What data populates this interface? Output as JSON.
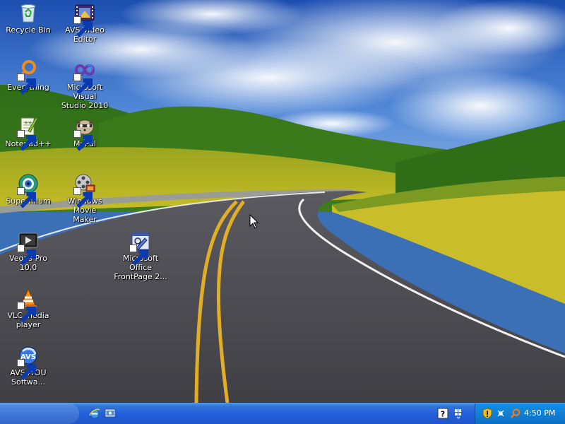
{
  "desktop": {
    "icons": [
      {
        "label": "Recycle Bin",
        "icon": "recycle-bin-icon",
        "shortcut": false
      },
      {
        "label": "AVS Video\nEditor",
        "icon": "film-strip-icon",
        "shortcut": true
      },
      {
        "label": "Everything",
        "icon": "magnifier-ring-icon",
        "shortcut": true
      },
      {
        "label": "Microsoft Visual\nStudio 2010",
        "icon": "infinity-icon",
        "shortcut": true
      },
      {
        "label": "Notepad++",
        "icon": "notepad-icon",
        "shortcut": true
      },
      {
        "label": "MyPal",
        "icon": "raccoon-icon",
        "shortcut": true
      },
      {
        "label": "Supermium",
        "icon": "globe-eye-icon",
        "shortcut": true
      },
      {
        "label": "Windows Movie\nMaker",
        "icon": "film-reel-icon",
        "shortcut": true
      },
      {
        "label": "Vegas Pro 10.0",
        "icon": "monitor-play-icon",
        "shortcut": true
      },
      {
        "label": "Microsoft Office\nFrontPage 2...",
        "icon": "frontpage-icon",
        "shortcut": true
      },
      {
        "label": "VLC media\nplayer",
        "icon": "traffic-cone-icon",
        "shortcut": true
      },
      {
        "label": "AVS4YOU\nSoftwa...",
        "icon": "avs-logo-icon",
        "shortcut": true
      }
    ]
  },
  "taskbar": {
    "quick_launch": [
      {
        "icon": "internet-explorer-icon"
      },
      {
        "icon": "show-desktop-icon"
      }
    ],
    "tray_extra": [
      {
        "icon": "help-icon"
      },
      {
        "icon": "windows-flag-icon"
      }
    ],
    "tray_icons": [
      {
        "icon": "security-shield-icon"
      },
      {
        "icon": "network-icon"
      },
      {
        "icon": "search-magnifier-icon"
      }
    ],
    "clock": "4:50 PM"
  },
  "colors": {
    "taskbar_blue": "#245edb",
    "tray_blue": "#0f7fd6",
    "sky": "#2d63c8",
    "grass": "#4b8a1e",
    "road": "#4e4e52",
    "road_line": "#e6b12a"
  }
}
